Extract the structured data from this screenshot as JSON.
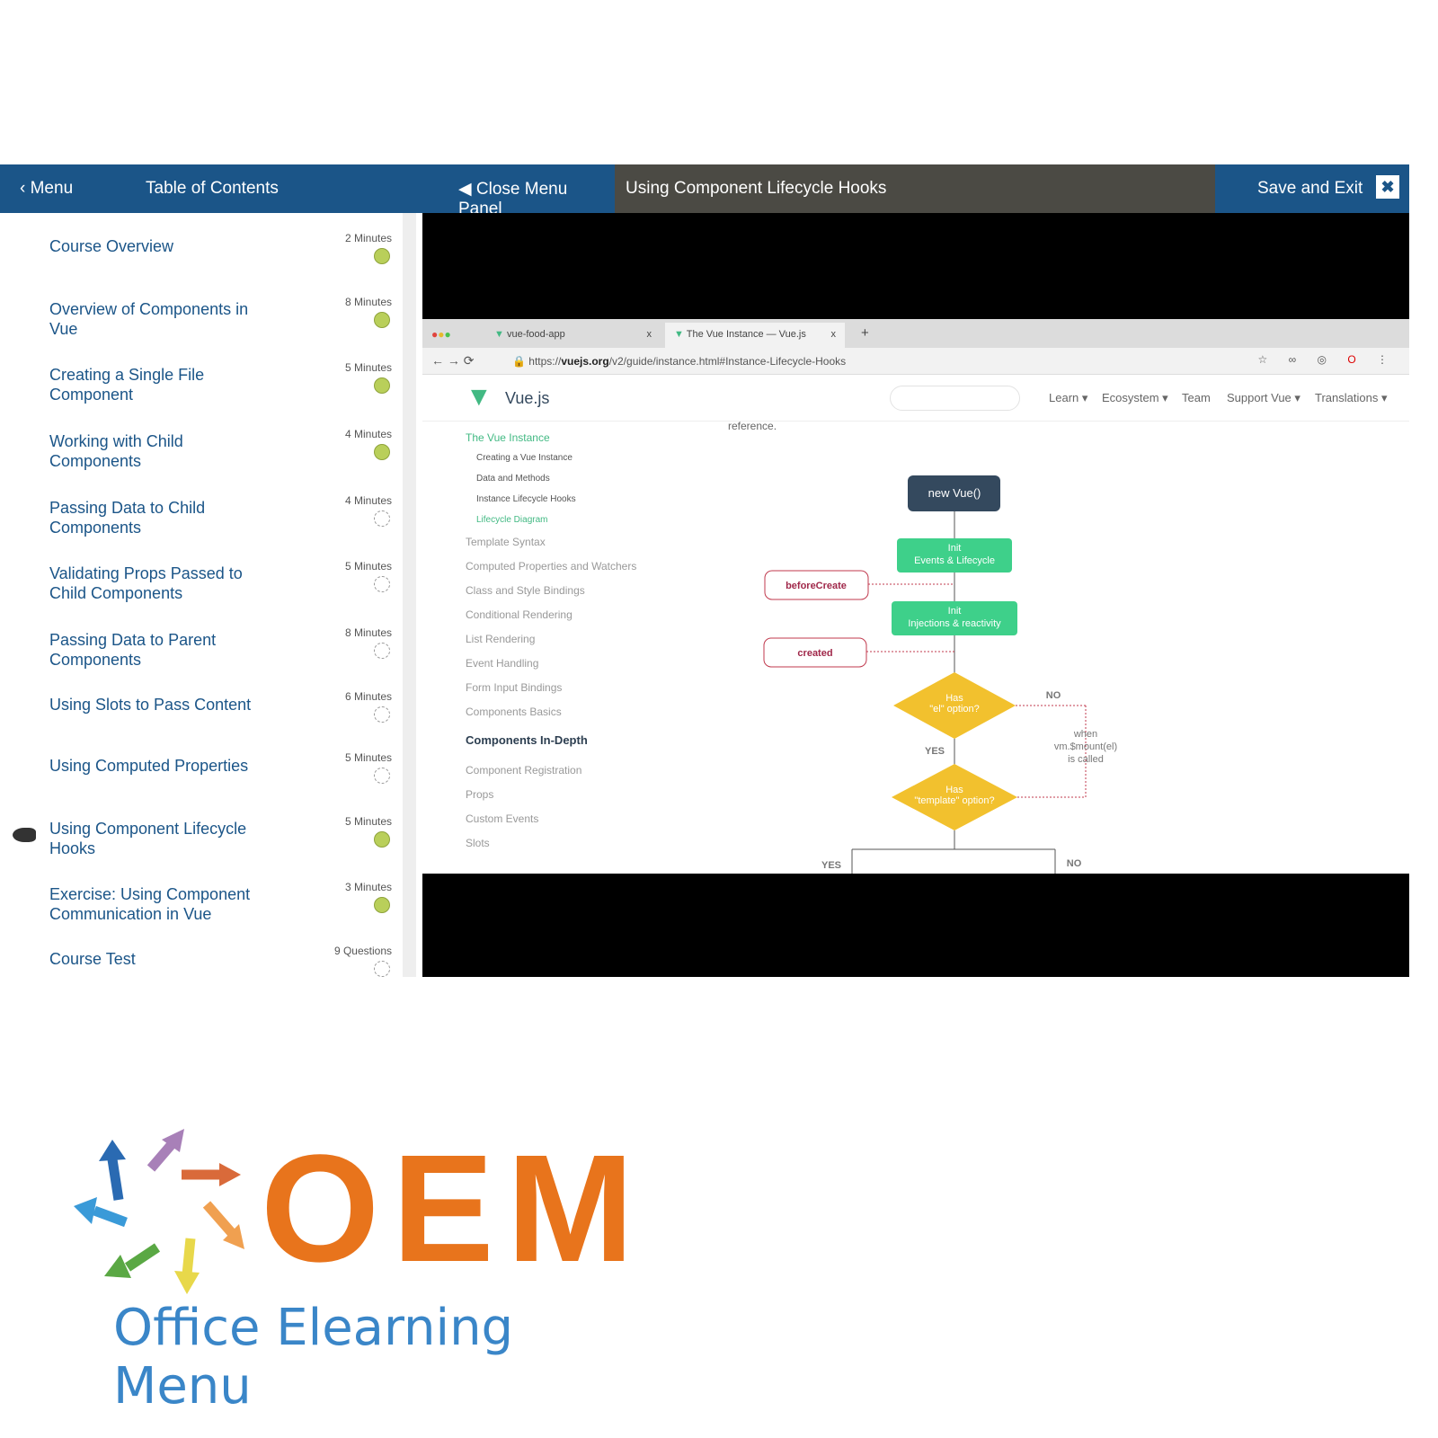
{
  "header": {
    "menu": "Menu",
    "toc": "Table of Contents",
    "close_panel": "Close Menu Panel",
    "lesson_title": "Using Component Lifecycle Hooks",
    "save_exit": "Save and Exit",
    "close_symbol": "✖"
  },
  "toc": [
    {
      "title": "Course Overview",
      "duration": "2 Minutes",
      "status": "complete"
    },
    {
      "title": "Overview of Components in Vue",
      "duration": "8 Minutes",
      "status": "complete"
    },
    {
      "title": "Creating a Single File Component",
      "duration": "5 Minutes",
      "status": "complete"
    },
    {
      "title": "Working with Child Components",
      "duration": "4 Minutes",
      "status": "complete"
    },
    {
      "title": "Passing Data to Child Components",
      "duration": "4 Minutes",
      "status": "incomplete"
    },
    {
      "title": "Validating Props Passed to Child Components",
      "duration": "5 Minutes",
      "status": "incomplete"
    },
    {
      "title": "Passing Data to Parent Components",
      "duration": "8 Minutes",
      "status": "incomplete"
    },
    {
      "title": "Using Slots to Pass Content",
      "duration": "6 Minutes",
      "status": "incomplete"
    },
    {
      "title": "Using Computed Properties",
      "duration": "5 Minutes",
      "status": "incomplete"
    },
    {
      "title": "Using Component Lifecycle Hooks",
      "duration": "5 Minutes",
      "status": "complete",
      "active": true
    },
    {
      "title": "Exercise: Using Component Communication in Vue",
      "duration": "3 Minutes",
      "status": "complete"
    },
    {
      "title": "Course Test",
      "duration": "9 Questions",
      "status": "incomplete"
    }
  ],
  "browser": {
    "tabs": [
      "vue-food-app",
      "The Vue Instance — Vue.js"
    ],
    "url_prefix": "https://",
    "url_domain": "vuejs.org",
    "url_path": "/v2/guide/instance.html#Instance-Lifecycle-Hooks",
    "brand": "Vue.js",
    "nav": [
      "Learn ▾",
      "Ecosystem ▾",
      "Team",
      "Support Vue ▾",
      "Translations ▾"
    ],
    "reference_text": "reference.",
    "sidebar": {
      "section": "The Vue Instance",
      "sub": [
        "Creating a Vue Instance",
        "Data and Methods",
        "Instance Lifecycle Hooks",
        "Lifecycle Diagram"
      ],
      "items": [
        "Template Syntax",
        "Computed Properties and Watchers",
        "Class and Style Bindings",
        "Conditional Rendering",
        "List Rendering",
        "Event Handling",
        "Form Input Bindings",
        "Components Basics"
      ],
      "section2": "Components In-Depth",
      "items2": [
        "Component Registration",
        "Props",
        "Custom Events",
        "Slots"
      ]
    },
    "diagram": {
      "start": "new Vue()",
      "init1a": "Init",
      "init1b": "Events & Lifecycle",
      "hook1": "beforeCreate",
      "init2a": "Init",
      "init2b": "Injections & reactivity",
      "hook2": "created",
      "q1a": "Has",
      "q1b": "\"el\" option?",
      "q2a": "Has",
      "q2b": "\"template\" option?",
      "yes": "YES",
      "no": "NO",
      "when1": "when",
      "when2": "vm.$mount(el)",
      "when3": "is called"
    }
  },
  "logo": {
    "letters": "OEM",
    "tagline": "Office Elearning Menu",
    "colors": {
      "orange": "#e8741c",
      "blue": "#3a86c8"
    }
  },
  "colors": {
    "header": "#1b5588",
    "title_bar": "#4b4a44",
    "complete": "#b9cf5a",
    "vue_green": "#42b983"
  }
}
